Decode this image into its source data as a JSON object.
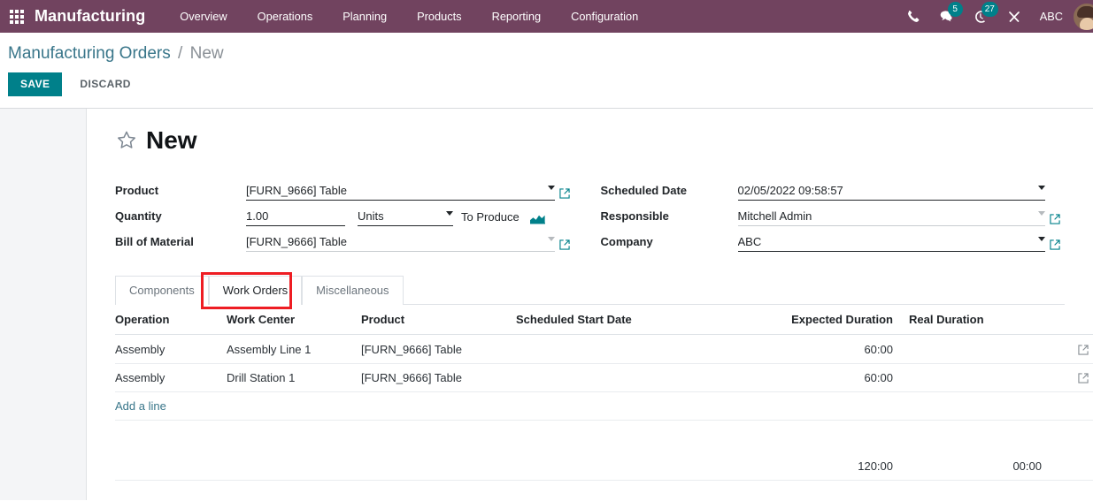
{
  "navbar": {
    "apps_icon": "apps-grid-icon",
    "brand": "Manufacturing",
    "menu": [
      {
        "label": "Overview"
      },
      {
        "label": "Operations"
      },
      {
        "label": "Planning"
      },
      {
        "label": "Products"
      },
      {
        "label": "Reporting"
      },
      {
        "label": "Configuration"
      }
    ],
    "systray": {
      "phone_icon": "phone-icon",
      "messages_icon": "chat-bubble-icon",
      "messages_count": "5",
      "activities_icon": "clock-icon",
      "activities_count": "27",
      "debug_icon": "tools-icon",
      "company": "ABC",
      "avatar_icon": "user-avatar"
    }
  },
  "control_panel": {
    "breadcrumb_root": "Manufacturing Orders",
    "breadcrumb_sep": "/",
    "breadcrumb_current": "New",
    "save_label": "SAVE",
    "discard_label": "DISCARD"
  },
  "form": {
    "star_icon": "star-outline-icon",
    "title": "New",
    "left_fields": {
      "product_label": "Product",
      "product_value": "[FURN_9666] Table",
      "quantity_label": "Quantity",
      "quantity_value": "1.00",
      "uom_value": "Units",
      "to_produce_label": "To Produce",
      "forecast_icon": "area-chart-icon",
      "bom_label": "Bill of Material",
      "bom_value": "[FURN_9666] Table"
    },
    "right_fields": {
      "scheduled_date_label": "Scheduled Date",
      "scheduled_date_value": "02/05/2022 09:58:57",
      "responsible_label": "Responsible",
      "responsible_value": "Mitchell Admin",
      "company_label": "Company",
      "company_value": "ABC"
    }
  },
  "notebook": {
    "tabs": [
      {
        "label": "Components",
        "active": false
      },
      {
        "label": "Work Orders",
        "active": true
      },
      {
        "label": "Miscellaneous",
        "active": false
      }
    ],
    "highlighted_tab": "Work Orders"
  },
  "work_orders_table": {
    "columns": [
      "Operation",
      "Work Center",
      "Product",
      "Scheduled Start Date",
      "Expected Duration",
      "Real Duration"
    ],
    "optional_columns_icon": "vertical-dots-icon",
    "rows": [
      {
        "operation": "Assembly",
        "work_center": "Assembly Line 1",
        "product": "[FURN_9666] Table",
        "scheduled_start_date": "",
        "expected_duration": "60:00",
        "real_duration": "",
        "open_icon": "external-link-icon",
        "delete_icon": "trash-icon"
      },
      {
        "operation": "Assembly",
        "work_center": "Drill Station 1",
        "product": "[FURN_9666] Table",
        "scheduled_start_date": "",
        "expected_duration": "60:00",
        "real_duration": "",
        "open_icon": "external-link-icon",
        "delete_icon": "trash-icon"
      }
    ],
    "add_line_label": "Add a line",
    "totals": {
      "expected_duration": "120:00",
      "real_duration": "00:00"
    }
  },
  "colors": {
    "navbar_bg": "#71435f",
    "accent_teal": "#00808a",
    "link_teal": "#39768a",
    "highlight_red": "#ee1d23",
    "page_bg": "#f4f5f7"
  }
}
